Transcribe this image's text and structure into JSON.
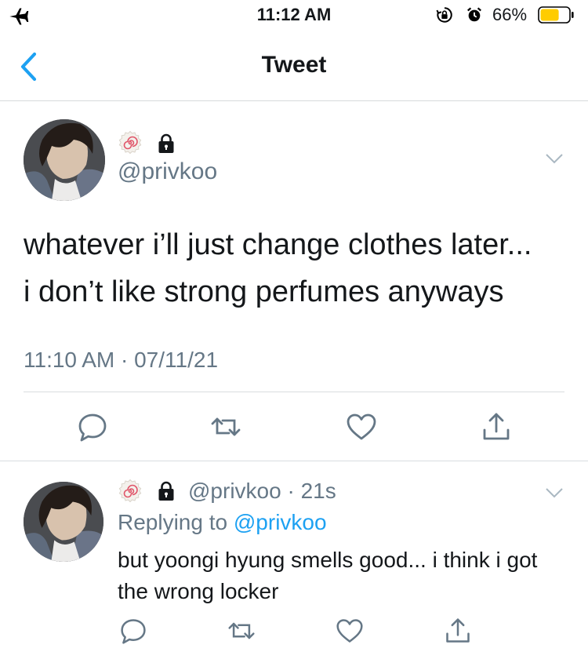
{
  "status_bar": {
    "time": "11:12 AM",
    "battery_percent": "66%",
    "battery_level": 0.66,
    "battery_color": "#ffcc00",
    "icons": [
      "airplane-icon",
      "rotation-lock-icon",
      "alarm-icon",
      "battery-icon"
    ]
  },
  "nav": {
    "title": "Tweet",
    "back_icon": "chevron-left-icon",
    "accent": "#1da1f2"
  },
  "tweet": {
    "handle": "@privkoo",
    "text_line1": "whatever i’ll just change clothes later...",
    "text_line2": "i don’t like strong perfumes anyways",
    "timestamp": "11:10 AM · 07/11/21",
    "badges": [
      "fish-cake-emoji-icon",
      "lock-icon"
    ],
    "actions": [
      "reply-icon",
      "retweet-icon",
      "like-icon",
      "share-icon"
    ]
  },
  "reply": {
    "handle_time": "@privkoo · 21s",
    "replying_prefix": "Replying to ",
    "replying_mention": "@privkoo",
    "text": "but yoongi hyung smells good... i think i got the wrong locker",
    "actions": [
      "reply-icon",
      "retweet-icon",
      "like-icon",
      "share-icon"
    ]
  },
  "colors": {
    "text": "#14171a",
    "secondary": "#657786",
    "link": "#1da1f2",
    "divider": "#d9dde0"
  }
}
